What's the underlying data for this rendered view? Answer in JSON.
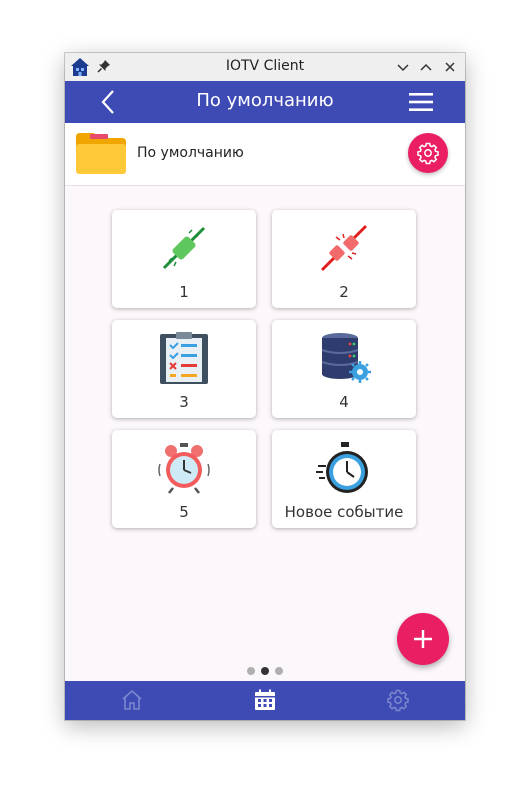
{
  "window": {
    "title": "IOTV Client"
  },
  "header": {
    "title": "По умолчанию"
  },
  "group": {
    "name": "По умолчанию"
  },
  "tiles": [
    {
      "label": "1",
      "icon": "plug-connected-icon"
    },
    {
      "label": "2",
      "icon": "plug-disconnected-icon"
    },
    {
      "label": "3",
      "icon": "clipboard-checklist-icon"
    },
    {
      "label": "4",
      "icon": "database-settings-icon"
    },
    {
      "label": "5",
      "icon": "alarm-clock-icon"
    },
    {
      "label": "Новое событие",
      "icon": "stopwatch-icon"
    }
  ],
  "pager": {
    "pages": 3,
    "current": 2
  },
  "bottom_nav": {
    "items": [
      "home-icon",
      "calendar-icon",
      "settings-icon"
    ],
    "active": 1
  },
  "colors": {
    "primary": "#3f4bb5",
    "accent": "#e91e63",
    "background": "#fcf7fb"
  }
}
